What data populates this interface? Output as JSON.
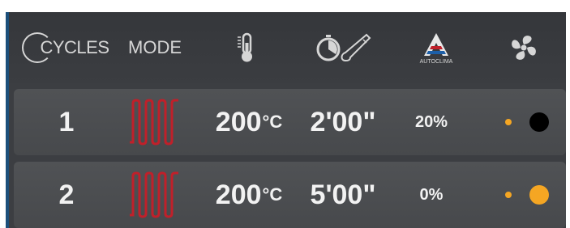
{
  "header": {
    "cycles_label": "CYCLES",
    "mode_label": "MODE",
    "temperature_icon": "thermometer-icon",
    "time_icon": "timer-probe-icon",
    "autoclima_icon": "autoclima-logo",
    "autoclima_label": "AUTOCLIMA",
    "fan_icon": "fan-icon"
  },
  "rows": [
    {
      "number": "1",
      "mode_icon": "heating-element-icon",
      "temperature": "200",
      "temp_unit": "°C",
      "time": "2'00\"",
      "humidity": "20%",
      "fan_small_color": "#f5a623",
      "fan_large_color": "#000000"
    },
    {
      "number": "2",
      "mode_icon": "heating-element-icon",
      "temperature": "200",
      "temp_unit": "°C",
      "time": "5'00\"",
      "humidity": "0%",
      "fan_small_color": "#f5a623",
      "fan_large_color": "#f5a623"
    }
  ],
  "colors": {
    "accent_red": "#c0202a",
    "edge_blue": "#1c4f7a",
    "orange": "#f5a623"
  }
}
